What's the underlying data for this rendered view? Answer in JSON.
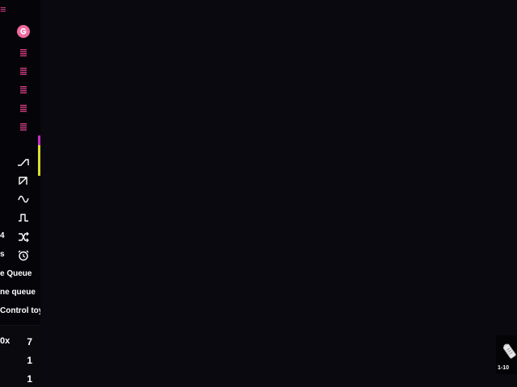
{
  "sidebar": {
    "menu_icon": "hamburger-icon",
    "logo_icon": "app-logo-icon",
    "list_icons": [
      "list-icon",
      "list-icon",
      "list-icon",
      "list-icon",
      "list-icon"
    ],
    "level": {
      "top_fraction": 0.24,
      "bottom_fraction": 0.76
    },
    "pattern_rows": [
      {
        "icon": "ramp-up-icon",
        "label": ""
      },
      {
        "icon": "sawtooth-icon",
        "label": ""
      },
      {
        "icon": "sine-wave-icon",
        "label": ""
      },
      {
        "icon": "square-wave-icon",
        "label": ""
      },
      {
        "icon": "shuffle-icon",
        "label": "4"
      },
      {
        "icon": "alarm-clock-icon",
        "label": "s"
      }
    ],
    "menu_items": [
      "e Queue",
      "ne queue",
      "Control toy"
    ],
    "stats": [
      {
        "label": "0x",
        "value": "7"
      },
      {
        "label": "",
        "value": "1"
      },
      {
        "label": "",
        "value": "1"
      }
    ]
  },
  "corner": {
    "icon": "battery-icon",
    "range_text": "1-10"
  },
  "colors": {
    "accent": "#e0408a",
    "level_top": "#c030c0",
    "level_bottom": "#d8e030",
    "background": "#0b0910"
  }
}
